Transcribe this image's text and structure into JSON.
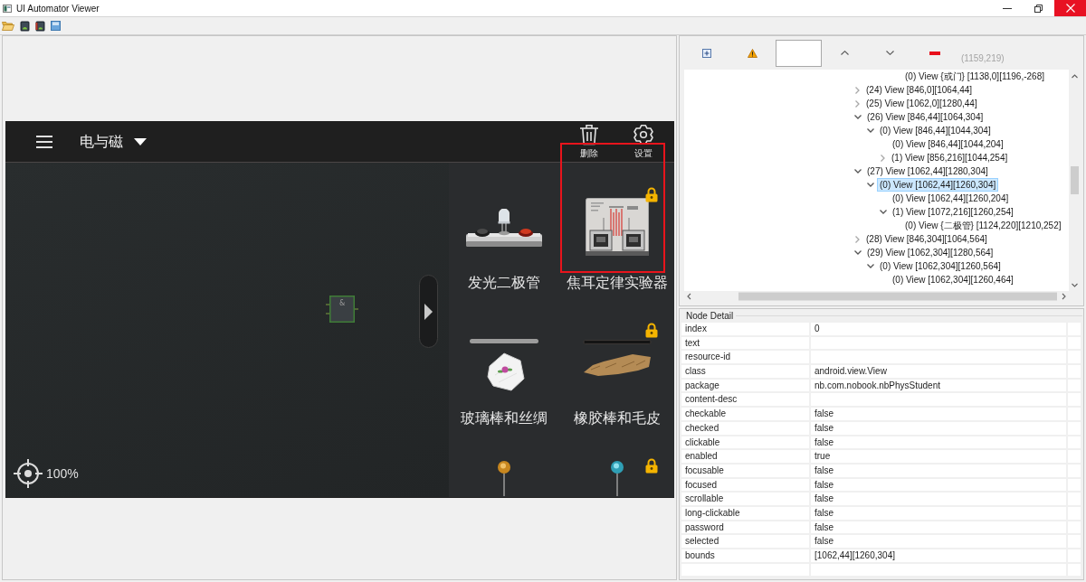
{
  "window": {
    "title": "UI Automator Viewer"
  },
  "device_screen": {
    "title": "电与磁",
    "actions": [
      {
        "kind": "trash",
        "label": "删除"
      },
      {
        "kind": "gear",
        "label": "设置"
      }
    ],
    "canvas": {
      "gate_symbol": "&",
      "zoom": "100%"
    },
    "palette": [
      {
        "kind": "led",
        "label": "发光二极管",
        "locked": false,
        "highlighted": false
      },
      {
        "kind": "joule",
        "label": "焦耳定律实验器",
        "locked": true,
        "highlighted": true
      },
      {
        "kind": "silk",
        "label": "玻璃棒和丝绸",
        "locked": false,
        "highlighted": false
      },
      {
        "kind": "fur",
        "label": "橡胶棒和毛皮",
        "locked": true,
        "highlighted": false
      },
      {
        "kind": "brasspin",
        "locked": false,
        "highlighted": false
      },
      {
        "kind": "tealpin",
        "locked": true,
        "highlighted": false
      }
    ]
  },
  "hierarchy": {
    "cursor_position": "(1159,219)",
    "tree": [
      {
        "children": [
          {
            "children": [
              {
                "children": [
                  {
                    "label": "(0) View {或门} [1138,0][1196,-268]",
                    "selected": false
                  }
                ]
              }
            ]
          }
        ]
      },
      {
        "label": "(24) View [846,0][1064,44]",
        "selected": false,
        "expanded": false
      },
      {
        "label": "(25) View [1062,0][1280,44]",
        "selected": false,
        "expanded": false
      },
      {
        "label": "(26) View [846,44][1064,304]",
        "selected": false,
        "expanded": true,
        "children": [
          {
            "label": "(0) View [846,44][1044,304]",
            "selected": false,
            "expanded": true,
            "children": [
              {
                "label": "(0) View [846,44][1044,204]",
                "selected": false
              },
              {
                "label": "(1) View [856,216][1044,254]",
                "selected": false,
                "expanded": false
              }
            ]
          }
        ]
      },
      {
        "label": "(27) View [1062,44][1280,304]",
        "selected": false,
        "expanded": true,
        "children": [
          {
            "label": "(0) View [1062,44][1260,304]",
            "selected": true,
            "expanded": true,
            "children": [
              {
                "label": "(0) View [1062,44][1260,204]",
                "selected": false
              },
              {
                "label": "(1) View [1072,216][1260,254]",
                "selected": false,
                "expanded": true,
                "children": [
                  {
                    "label": "(0) View {二极管} [1124,220][1210,252]",
                    "selected": false
                  }
                ]
              }
            ]
          }
        ]
      },
      {
        "label": "(28) View [846,304][1064,564]",
        "selected": false,
        "expanded": false
      },
      {
        "label": "(29) View [1062,304][1280,564]",
        "selected": false,
        "expanded": true,
        "children": [
          {
            "label": "(0) View [1062,304][1260,564]",
            "selected": false,
            "expanded": true,
            "children": [
              {
                "label": "(0) View [1062,304][1260,464]",
                "selected": false
              }
            ]
          }
        ]
      }
    ]
  },
  "node_detail": {
    "title": "Node Detail",
    "rows": [
      {
        "key": "index",
        "value": "0"
      },
      {
        "key": "text"
      },
      {
        "key": "resource-id"
      },
      {
        "key": "class",
        "value": "android.view.View"
      },
      {
        "key": "package",
        "value": "nb.com.nobook.nbPhysStudent"
      },
      {
        "key": "content-desc"
      },
      {
        "key": "checkable",
        "value": "false"
      },
      {
        "key": "checked",
        "value": "false"
      },
      {
        "key": "clickable",
        "value": "false"
      },
      {
        "key": "enabled",
        "value": "true"
      },
      {
        "key": "focusable",
        "value": "false"
      },
      {
        "key": "focused",
        "value": "false"
      },
      {
        "key": "scrollable",
        "value": "false"
      },
      {
        "key": "long-clickable",
        "value": "false"
      },
      {
        "key": "password",
        "value": "false"
      },
      {
        "key": "selected",
        "value": "false"
      },
      {
        "key": "bounds",
        "value": "[1062,44][1260,304]"
      }
    ]
  }
}
